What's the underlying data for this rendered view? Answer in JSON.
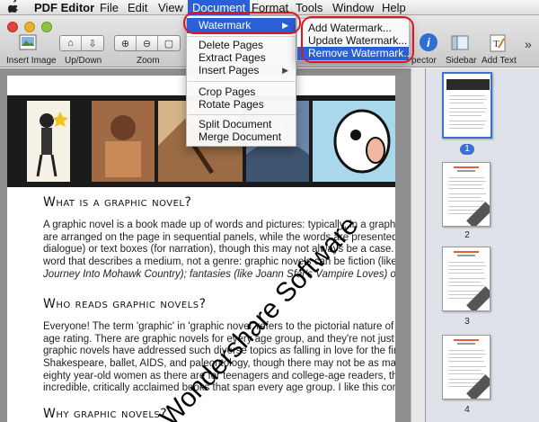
{
  "menubar": {
    "apple": "",
    "app_name": "PDF Editor",
    "items": [
      "File",
      "Edit",
      "View",
      "Document",
      "Format",
      "Tools",
      "Window",
      "Help"
    ]
  },
  "toolbar": {
    "insert_image": "Insert Image",
    "up_down": "Up/Down",
    "zoom": "Zoom",
    "inspector": "pector",
    "sidebar": "Sidebar",
    "add_text": "Add Text",
    "more": "»"
  },
  "document_menu": {
    "watermark": "Watermark",
    "delete_pages": "Delete Pages",
    "extract_pages": "Extract Pages",
    "insert_pages": "Insert Pages",
    "crop_pages": "Crop Pages",
    "rotate_pages": "Rotate Pages",
    "split_document": "Split Document",
    "merge_document": "Merge Document"
  },
  "watermark_submenu": {
    "add": "Add Watermark...",
    "update": "Update Watermark...",
    "remove": "Remove Watermark..."
  },
  "page": {
    "h1": "What is a graphic novel?",
    "p1": [
      "A graphic novel is a book made up of words and pictures: typically, in a graphic n",
      "are arranged on the page in sequential panels, while the words are presented in sp",
      "dialogue) or text boxes (for narration), though this may not always be a case.  'G",
      "word that describes a medium, not a genre: graphic novels can be fiction (like Ge",
      "Journey Into Mohawk Country); fantasies (like Joann Sfar's Vampire Loves) or anyth"
    ],
    "h2": "Who reads graphic novels?",
    "p2": [
      "Everyone!  The term 'graphic' in 'graphic novel' refers to the pictorial nature of the m",
      "age rating.  There are graphic novels for every age group, and they're not just abo",
      "graphic novels have addressed such diverse topics as falling in love for the first tim",
      "Shakespeare, ballet, AIDS, and paleontology, though there may not be as many g",
      "eighty year-old women as there are for teenagers and college-age readers, the med",
      "incredible, critically acclaimed books that span every age group.  I like this comm"
    ],
    "h3": "Why graphic novels?",
    "watermark": "Wondershare Software"
  },
  "thumbnails": [
    {
      "label": "1",
      "selected": true
    },
    {
      "label": "2",
      "selected": false
    },
    {
      "label": "3",
      "selected": false
    },
    {
      "label": "4",
      "selected": false
    }
  ],
  "colors": {
    "menu_highlight": "#2a5fd6",
    "annotation_ring": "#e0141e"
  }
}
